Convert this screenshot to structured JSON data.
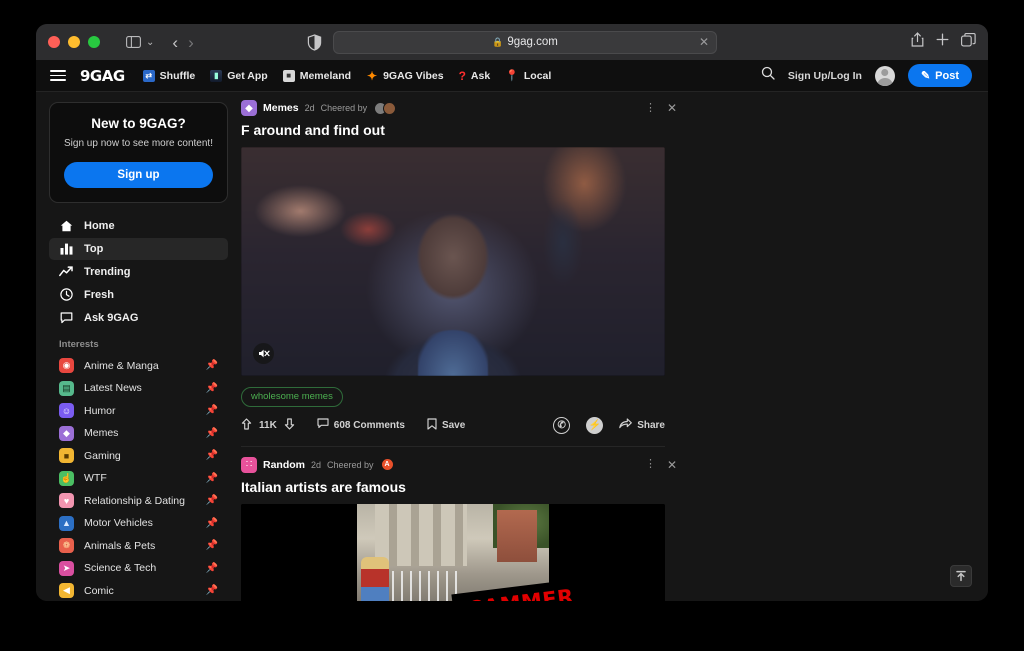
{
  "browser": {
    "url_text": "9gag.com",
    "lock_icon": "lock-icon",
    "sidebar_toggle_icon": "sidebar-toggle-icon",
    "back_icon": "‹",
    "forward_icon": "›",
    "chevron_icon": "⌄",
    "shield_icon": "privacy-shield-icon",
    "clear_icon": "✕",
    "share_icon": "share-icon",
    "new_tab_icon": "+",
    "tabs_icon": "tabs-overview-icon"
  },
  "header": {
    "logo": "9GAG",
    "menu_icon": "hamburger-menu-icon",
    "nav": [
      {
        "label": "Shuffle",
        "icon": "shuffle-icon"
      },
      {
        "label": "Get App",
        "icon": "get-app-icon"
      },
      {
        "label": "Memeland",
        "icon": "memeland-icon"
      },
      {
        "label": "9GAG Vibes",
        "icon": "vibes-icon"
      },
      {
        "label": "Ask",
        "icon": "question-mark-icon"
      },
      {
        "label": "Local",
        "icon": "location-pin-icon"
      }
    ],
    "search_icon": "search-icon",
    "signin_label": "Sign Up/Log In",
    "avatar": "user-avatar",
    "post_label": "Post",
    "post_icon": "pencil-icon",
    "accent_color": "#0b76ef"
  },
  "sidebar": {
    "signup_card": {
      "title": "New to 9GAG?",
      "subtitle": "Sign up now to see more content!",
      "button_label": "Sign up"
    },
    "nav": [
      {
        "label": "Home",
        "icon": "home-icon",
        "active": false
      },
      {
        "label": "Top",
        "icon": "bar-chart-icon",
        "active": true
      },
      {
        "label": "Trending",
        "icon": "trending-up-icon",
        "active": false
      },
      {
        "label": "Fresh",
        "icon": "clock-icon",
        "active": false
      },
      {
        "label": "Ask 9GAG",
        "icon": "comment-icon",
        "active": false
      }
    ],
    "interests_header": "Interests",
    "interests": [
      {
        "label": "Anime & Manga",
        "icon": "anime-icon",
        "color": "#e8473f",
        "glyph": "◉"
      },
      {
        "label": "Latest News",
        "icon": "news-icon",
        "color": "#56b98c",
        "glyph": "▤"
      },
      {
        "label": "Humor",
        "icon": "humor-icon",
        "color": "#7a5cf0",
        "glyph": "☺"
      },
      {
        "label": "Memes",
        "icon": "memes-icon",
        "color": "#9b6fd6",
        "glyph": "◆"
      },
      {
        "label": "Gaming",
        "icon": "gaming-icon",
        "color": "#f2b632",
        "glyph": "■"
      },
      {
        "label": "WTF",
        "icon": "wtf-icon",
        "color": "#4bbf63",
        "glyph": "☝"
      },
      {
        "label": "Relationship & Dating",
        "icon": "relationship-icon",
        "color": "#f295b0",
        "glyph": "♥"
      },
      {
        "label": "Motor Vehicles",
        "icon": "motor-icon",
        "color": "#2c6fc4",
        "glyph": "▲"
      },
      {
        "label": "Animals & Pets",
        "icon": "animals-icon",
        "color": "#e8604c",
        "glyph": "❁"
      },
      {
        "label": "Science & Tech",
        "icon": "science-icon",
        "color": "#d94fa0",
        "glyph": "➤"
      },
      {
        "label": "Comic",
        "icon": "comic-icon",
        "color": "#f2b632",
        "glyph": "◀"
      }
    ],
    "pin_icon": "pin-icon"
  },
  "feed": {
    "posts": [
      {
        "category": "Memes",
        "category_color": "#9b6fd6",
        "category_glyph": "◆",
        "age": "2d",
        "cheered_label": "Cheered by",
        "cheerers": [
          {
            "initial": "",
            "color": "#7d7d7d"
          },
          {
            "initial": "",
            "color": "#8a5a3a"
          }
        ],
        "title": "F around and find out",
        "media_type": "video",
        "mute_icon": "speaker-muted-icon",
        "tag": "wholesome memes",
        "tag_color": "#4caf50",
        "upvotes": "11K",
        "upvote_icon": "upvote-arrow-icon",
        "downvote_icon": "downvote-arrow-icon",
        "comments": "608 Comments",
        "comment_icon": "comment-bubble-icon",
        "save_label": "Save",
        "save_icon": "bookmark-icon",
        "share_label": "Share",
        "share_icon": "share-arrow-icon",
        "whatsapp_icon": "whatsapp-icon",
        "messenger_icon": "messenger-icon",
        "kebab_icon": "more-options-icon",
        "close_icon": "close-icon"
      },
      {
        "category": "Random",
        "category_color": "#e8529b",
        "category_glyph": "∷",
        "age": "2d",
        "cheered_label": "Cheered by",
        "cheerers": [
          {
            "initial": "A",
            "color": "#e8502a"
          }
        ],
        "title": "Italian artists are famous",
        "media_type": "image",
        "media_overlay_text": "SCAMMER",
        "kebab_icon": "more-options-icon",
        "close_icon": "close-icon"
      }
    ],
    "scroll_top_icon": "scroll-to-top-icon"
  }
}
